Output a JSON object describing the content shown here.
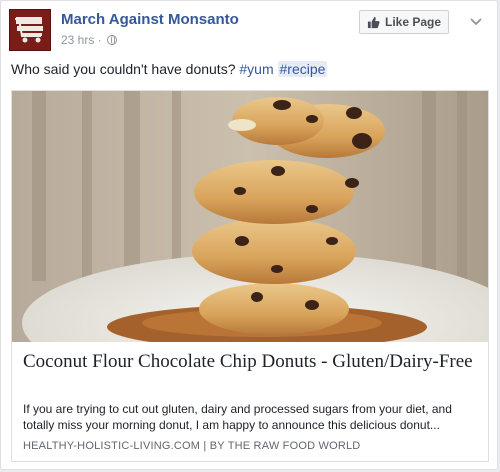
{
  "post": {
    "page_name": "March Against Monsanto",
    "time": "23 hrs",
    "meta_separator": "·",
    "icons": {
      "privacy": "globe-icon",
      "like": "thumbs-up-icon",
      "options": "chevron-down-icon",
      "avatar": "shopping-cart-icon"
    },
    "like_button_label": "Like Page",
    "text_prefix": "Who said you couldn't have donuts?",
    "hashtags": [
      "#yum",
      "#recipe"
    ]
  },
  "link": {
    "title": "Coconut Flour Chocolate Chip Donuts - Gluten/Dairy-Free",
    "description": "If you are trying to cut out gluten, dairy and processed sugars from your diet, and totally miss your morning donut, I am happy to announce this delicious donut...",
    "domain": "HEALTHY-HOLISTIC-LIVING.COM",
    "by_separator": "|",
    "by_label": "BY",
    "author": "THE RAW FOOD WORLD"
  },
  "colors": {
    "link_blue": "#365899",
    "avatar_red": "#7a1c18",
    "muted": "#90949c"
  }
}
